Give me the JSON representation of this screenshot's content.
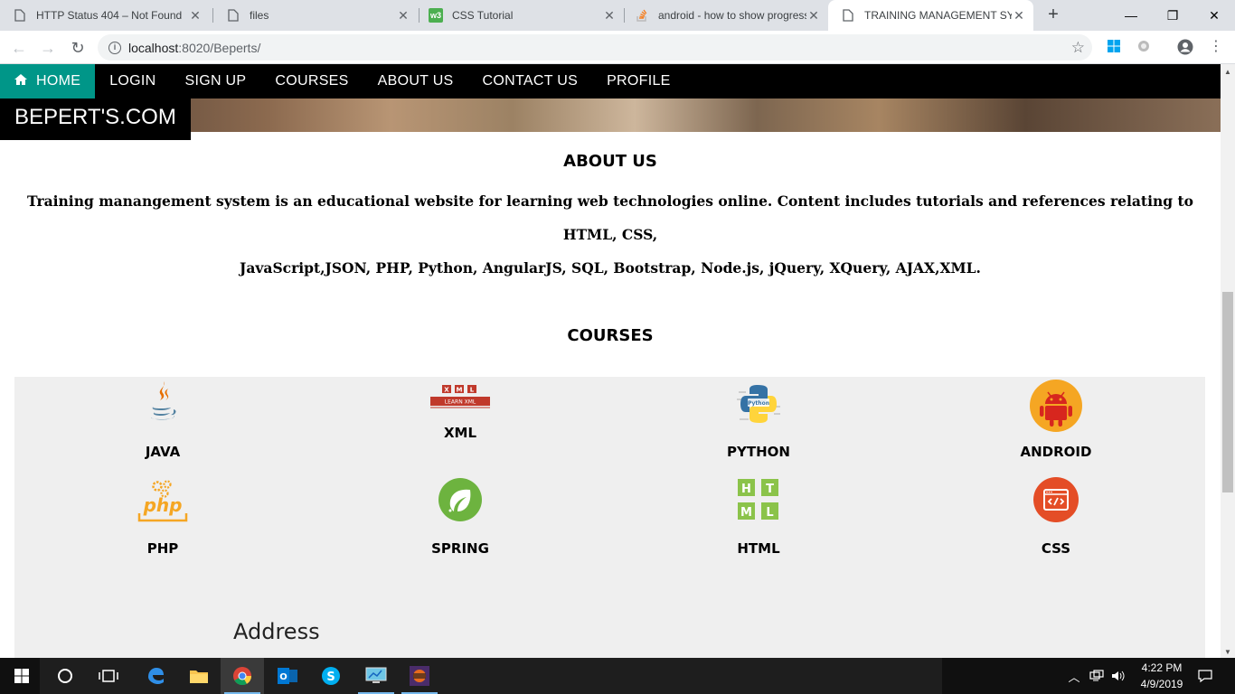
{
  "browser": {
    "tabs": [
      {
        "title": "HTTP Status 404 – Not Found",
        "icon": "file-icon"
      },
      {
        "title": "files",
        "icon": "file-icon"
      },
      {
        "title": "CSS Tutorial",
        "icon": "w3schools-icon"
      },
      {
        "title": "android - how to show progress",
        "icon": "stackoverflow-icon"
      },
      {
        "title": "TRAINING MANAGEMENT SYSTEM",
        "icon": "file-icon"
      }
    ],
    "url_host": "localhost",
    "url_path": ":8020/Beperts/"
  },
  "nav": {
    "items": [
      "HOME",
      "LOGIN",
      "SIGN UP",
      "COURSES",
      "ABOUT US",
      "CONTACT US",
      "PROFILE"
    ],
    "active": "HOME"
  },
  "brand": "BEPERT'S.COM",
  "about": {
    "title": "ABOUT US",
    "line1": "Training manangement system is an educational website for learning web technologies online. Content includes tutorials and references relating to HTML, CSS,",
    "line2": "JavaScript,JSON, PHP, Python, AngularJS, SQL, Bootstrap, Node.js, jQuery, XQuery, AJAX,XML."
  },
  "courses": {
    "title": "COURSES",
    "items": [
      {
        "name": "JAVA",
        "icon": "java-icon"
      },
      {
        "name": "XML",
        "icon": "xml-icon"
      },
      {
        "name": "PYTHON",
        "icon": "python-icon"
      },
      {
        "name": "ANDROID",
        "icon": "android-icon"
      },
      {
        "name": "PHP",
        "icon": "php-icon"
      },
      {
        "name": "SPRING",
        "icon": "spring-icon"
      },
      {
        "name": "HTML",
        "icon": "html-icon"
      },
      {
        "name": "CSS",
        "icon": "css-icon"
      }
    ],
    "xml_banner": "LEARN XML"
  },
  "address": {
    "heading": "Address"
  },
  "clock": {
    "time": "4:22 PM",
    "date": "4/9/2019"
  },
  "colors": {
    "nav_active": "#009688",
    "nav_bg": "#000000",
    "panel_bg": "#efefef"
  }
}
